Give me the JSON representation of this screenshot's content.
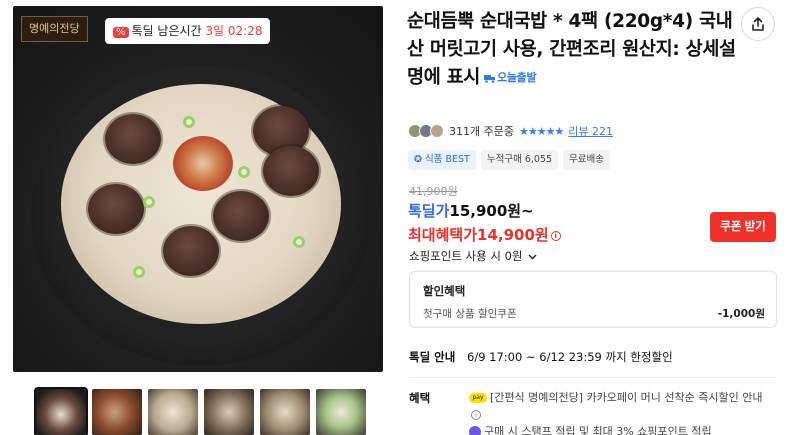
{
  "badges": {
    "brand": "명예의전당",
    "timer_prefix": "톡딜 남은시간",
    "timer_value": "3일 02:28"
  },
  "product": {
    "title": "순대듬뿍 순대국밥 * 4팩 (220g*4) 국내산 머릿고기 사용, 간편조리 원산지: 상세설명에 표시",
    "delivery_badge": "오늘출발",
    "order_count": "311개 주문중",
    "review_label": "리뷰 221",
    "rating": 5
  },
  "tags": [
    "식품 BEST",
    "누적구매 6,055",
    "무료배송"
  ],
  "price": {
    "original": "41,900원",
    "deal_label": "톡딜가",
    "deal_value": "15,900원~",
    "max_label": "최대혜택가",
    "max_value": "14,900원",
    "point_text": "쇼핑포인트 사용 시 0원"
  },
  "coupon_button": "쿠폰 받기",
  "discount": {
    "header": "할인혜택",
    "item": "첫구매 상품 할인쿠폰",
    "amount": "-1,000원"
  },
  "deal_info": {
    "label": "톡딜 안내",
    "value": "6/9 17:00 ~ 6/12 23:59 까지 한정할인"
  },
  "benefit": {
    "label": "혜택",
    "kakaopay_text": "[간편식 명예의전당] 카카오페이 머니 선착순 즉시할인 안내",
    "second_text": "구매 시 스탬프 적립 및 최대 3% 쇼핑포인트 적립"
  },
  "colors": {
    "accent_blue": "#2f6bd8",
    "accent_red": "#f0312c",
    "star_blue": "#3a7bf6"
  },
  "icons": [
    "share-icon",
    "percent-icon",
    "truck-icon",
    "info-icon",
    "chevron-down-icon",
    "kakaopay-icon",
    "star-icon"
  ]
}
